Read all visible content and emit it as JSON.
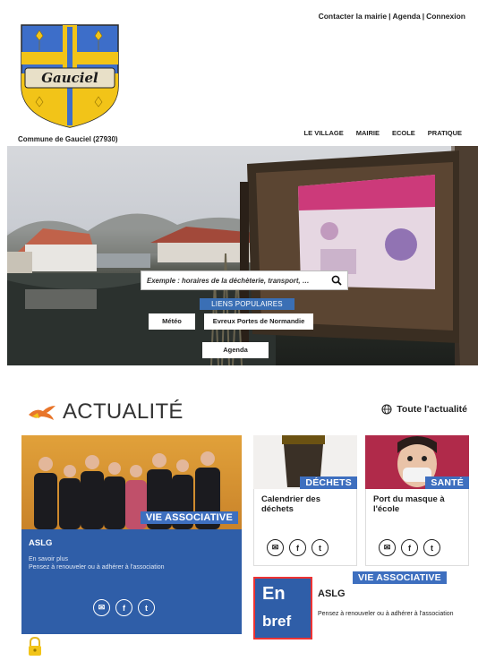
{
  "header": {
    "top_links": [
      "Contacter la mairie",
      "Agenda",
      "Connexion"
    ],
    "logo_text": "Gauciel",
    "commune_label": "Commune de Gauciel (27930)",
    "nav": [
      "LE VILLAGE",
      "MAIRIE",
      "ECOLE",
      "PRATIQUE"
    ]
  },
  "hero": {
    "search_placeholder": "Exemple : horaires de la déchèterie, transport, …",
    "liens_label": "LIENS POPULAIRES",
    "popular_links": [
      "Météo",
      "Evreux Portes de Normandie",
      "Agenda"
    ]
  },
  "actualite": {
    "title": "ACTUALITÉ",
    "all_link": "Toute l'actualité",
    "big_card": {
      "tag": "VIE ASSOCIATIVE",
      "title": "ASLG",
      "desc_line1": "En savoir plus",
      "desc_line2": "Pensez à renouveler ou à adhérer à l'association"
    },
    "cards": [
      {
        "tag": "DÉCHETS",
        "title": "Calendrier des déchets"
      },
      {
        "tag": "SANTÉ",
        "title": "Port du masque à l'école"
      }
    ],
    "en_bref": {
      "tag": "VIE ASSOCIATIVE",
      "box_line1": "En",
      "box_line2": "bref",
      "title": "ASLG",
      "desc": "Pensez à renouveler ou à adhérer à l'association"
    }
  },
  "colors": {
    "accent_blue": "#2f5ea8",
    "tag_blue": "#3e6fbf",
    "orange": "#e8752a",
    "gold": "#f2c418"
  },
  "icons": [
    "search-icon",
    "globe-icon",
    "mail-icon",
    "facebook-icon",
    "twitter-icon",
    "lock-icon",
    "swallow-logo-icon"
  ]
}
